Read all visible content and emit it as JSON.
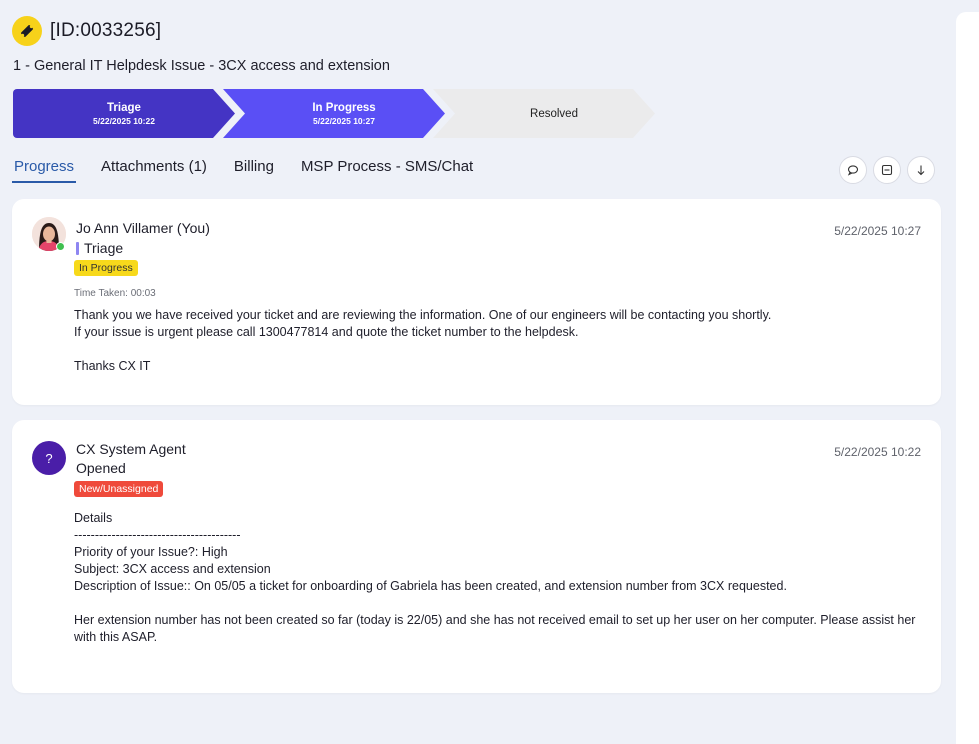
{
  "ticket": {
    "id": "[ID:0033256]",
    "subject": "1 - General IT Helpdesk Issue - 3CX access and extension",
    "icon": "ticket-icon",
    "accent_color": "#f7d21a"
  },
  "stages": [
    {
      "name": "Triage",
      "date": "5/22/2025 10:22",
      "color": "#4434c4"
    },
    {
      "name": "In Progress",
      "date": "5/22/2025 10:27",
      "color": "#5a4ff5"
    },
    {
      "name": "Resolved",
      "date": "",
      "color": "#ebebec"
    }
  ],
  "tabs": [
    {
      "label": "Progress",
      "active": true
    },
    {
      "label": "Attachments (1)",
      "active": false
    },
    {
      "label": "Billing",
      "active": false
    },
    {
      "label": "MSP Process - SMS/Chat",
      "active": false
    }
  ],
  "tools": [
    {
      "icon": "comment-icon"
    },
    {
      "icon": "collapse-icon"
    },
    {
      "icon": "arrow-down-icon"
    }
  ],
  "entries": [
    {
      "author": "Jo Ann Villamer (You)",
      "status": "Triage",
      "badge": "In Progress",
      "time_taken": "Time Taken: 00:03",
      "date": "5/22/2025 10:27",
      "body": "Thank you we have received your ticket and are reviewing the information. One of our engineers will be contacting you shortly.\nIf your issue is urgent please call 1300477814 and quote the ticket number to the helpdesk.\n\nThanks CX IT"
    },
    {
      "author": "CX System Agent",
      "status": "Opened",
      "badge": "New/Unassigned",
      "avatar_text": "?",
      "date": "5/22/2025 10:22",
      "body": "Details\n----------------------------------------\nPriority of your Issue?: High\nSubject: 3CX access and extension\nDescription of Issue:: On 05/05 a ticket for onboarding of Gabriela has been created, and extension number from 3CX requested.\n\nHer extension number has not been created so far (today is 22/05) and she has not received email to set up her user on her computer. Please assist her with this ASAP."
    }
  ]
}
